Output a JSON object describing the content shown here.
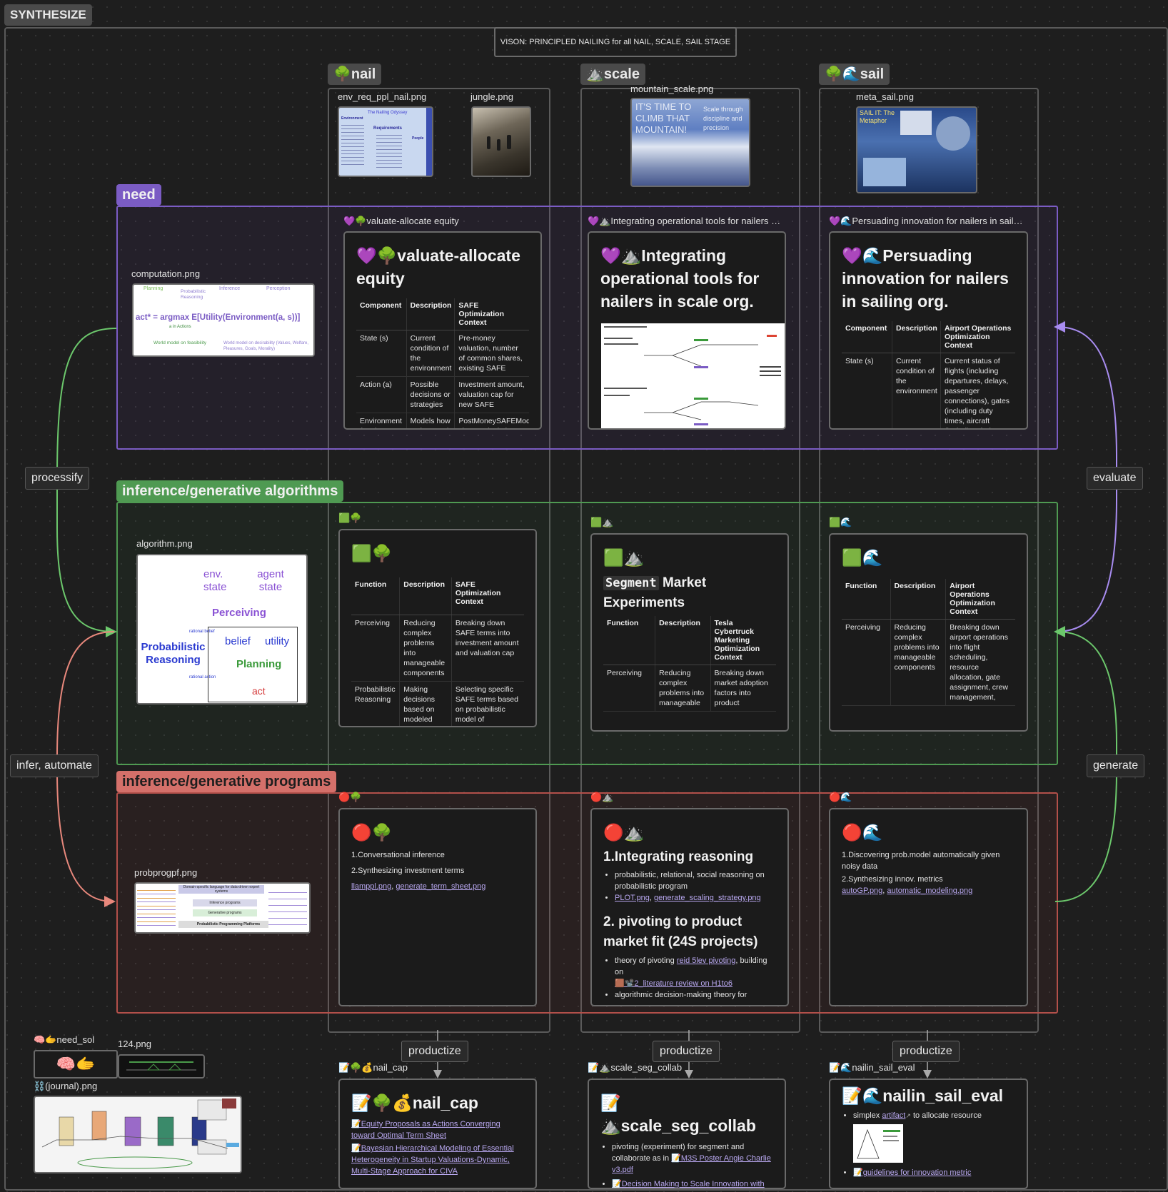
{
  "canvas_title": "SYNTHESIZE",
  "vision": "VISON: PRINCIPLED NAILING for all NAIL, SCALE, SAIL STAGE",
  "columns": {
    "nail": {
      "label": "🌳nail"
    },
    "scale": {
      "label": "⛰️scale"
    },
    "sail": {
      "label": "🌳🌊sail"
    }
  },
  "images": {
    "env_req": "env_req_ppl_nail.png",
    "jungle": "jungle.png",
    "mountain": "mountain_scale.png",
    "meta_sail": "meta_sail.png",
    "computation": "computation.png",
    "algorithm": "algorithm.png",
    "probprog": "probprogpf.png",
    "img124": "124.png",
    "journal": "⛓️(journal).png",
    "need_sol": "🧠🫱need_sol",
    "need_sol_emoji": "🧠🫱"
  },
  "thumb_text": {
    "env_title": "The Nailing Odyssey",
    "env_env": "Environment",
    "env_req": "Requirements",
    "env_people": "People",
    "mountain": "IT'S TIME TO CLIMB THAT MOUNTAIN!",
    "mountain_sub": "Scale through discipline and precision",
    "meta": "SAIL IT: The Metaphor"
  },
  "computation_fig": {
    "planning": "Planning",
    "probabilistic": "Probabilistic Reasoning",
    "inference": "Inference",
    "perception": "Perception",
    "formula": "act* = argmax E[Utility(Environment(a, s))]",
    "sub": "a in Actions",
    "feasibility": "World model on feasibility",
    "desirability": "World model on desirability (Values, Welfare, Pleasures, Goals, Morality)"
  },
  "algorithm_fig": {
    "env_state": "env. state",
    "agent_state": "agent state",
    "perceiving": "Perceiving",
    "belief": "belief",
    "utility": "utility",
    "planning": "Planning",
    "act": "act",
    "prob_reasoning": "Probabilistic Reasoning",
    "rational_belief": "rational belief",
    "rational_action": "rational action"
  },
  "probprog_fig": {
    "dsl": "Domain-specific language for data-driven expert systems",
    "inference_programs": "Inference programs",
    "generative_programs": "Generative programs",
    "platforms": "Probabilistic Programming Platforms"
  },
  "groups": {
    "need": "need",
    "algorithms": "inference/generative algorithms",
    "programs": "inference/generative programs"
  },
  "side_labels": {
    "processify": "processify",
    "infer": "infer, automate",
    "evaluate": "evaluate",
    "generate": "generate",
    "productize": "productize"
  },
  "need_cards": [
    {
      "label": "💜🌳valuate-allocate equity",
      "title": "💜🌳valuate-allocate equity",
      "headers": [
        "Component",
        "Description",
        "SAFE Optimization Context"
      ],
      "rows": [
        [
          "State (s)",
          "Current condition of the environment",
          "Pre-money valuation, number of common shares, existing SAFE"
        ],
        [
          "Action (a)",
          "Possible decisions or strategies",
          "Investment amount, valuation cap for new SAFE"
        ],
        [
          "Environment (Env)",
          "Models how actions and",
          "PostMoneySAFEModel class, calculating"
        ]
      ]
    },
    {
      "label": "💜⛰️Integrating operational tools for nailers …",
      "title": "💜⛰️Integrating operational tools for nailers in scale org."
    },
    {
      "label": "💜🌊Persuading innovation for nailers in sail…",
      "title": "💜🌊Persuading innovation for nailers in sailing org.",
      "headers": [
        "Component",
        "Description",
        "Airport Operations Optimization Context"
      ],
      "rows": [
        [
          "State (s)",
          "Current condition of the environment",
          "Current status of flights (including departures, delays, passenger connections), gates (including duty times, aircraft (including their capacity), and resources (manpower and eq"
        ]
      ]
    }
  ],
  "algo_cards": [
    {
      "label": "🟩🌳",
      "title": "🟩🌳",
      "headers": [
        "Function",
        "Description",
        "SAFE Optimization Context"
      ],
      "rows": [
        [
          "Perceiving",
          "Reducing complex problems into manageable components",
          "Breaking down SAFE terms into investment amount and valuation cap"
        ],
        [
          "Probabilistic Reasoning",
          "Making decisions based on modeled uncertainty",
          "Selecting specific SAFE terms based on probabilistic model of"
        ]
      ]
    },
    {
      "label": "🟩⛰️",
      "title": "🟩⛰️",
      "segment_code": "Segment",
      "segment_rest": "Market Experiments",
      "headers": [
        "Function",
        "Description",
        "Tesla Cybertruck Marketing Optimization Context"
      ],
      "rows": [
        [
          "Perceiving",
          "Reducing complex problems into manageable",
          "Breaking down market adoption factors into product"
        ]
      ]
    },
    {
      "label": "🟩🌊",
      "title": "🟩🌊",
      "headers": [
        "Function",
        "Description",
        "Airport Operations Optimization Context"
      ],
      "rows": [
        [
          "Perceiving",
          "Reducing complex problems into manageable components",
          "Breaking down airport operations into flight scheduling, resource allocation, gate assignment, crew management,"
        ]
      ]
    }
  ],
  "prog_cards": [
    {
      "label": "🔴🌳",
      "title": "🔴🌳",
      "lines": [
        "1.Conversational inference",
        "2.Synthesizing investment terms"
      ],
      "link1": "llamppl.png",
      "sep": ", ",
      "link2": "generate_term_sheet.png"
    },
    {
      "label": "🔴⛰️",
      "title": "🔴⛰️",
      "h1": "1.Integrating reasoning",
      "b1": "probabilistic, relational, social reasoning on probabilistic program",
      "b2_link1": "PLOT.png",
      "b2_sep": ", ",
      "b2_link2": "generate_scaling_strategy.png",
      "h2": "2. pivoting to product market fit (24S projects)",
      "b3_pre": "theory of pivoting ",
      "b3_link": "reid 5lev pivoting",
      "b3_post": ", building on",
      "b3_link2": "🟫📽️2_literature review on H1to6",
      "b4": "algorithmic decision-making theory for"
    },
    {
      "label": "🔴🌊",
      "title": "🔴🌊",
      "lines": [
        "1.Discovering prob.model automatically given noisy data",
        "2.Synthesizing innov. metrics"
      ],
      "link1": "autoGP.png",
      "sep": ", ",
      "link2": "automatic_modeling.png"
    }
  ],
  "prod_cards": [
    {
      "label": "📝🌳💰nail_cap",
      "title": "📝🌳💰nail_cap",
      "links": [
        "📝Equity Proposals as Actions Converging toward Optimal Term Sheet",
        "📝Bayesian Hierarchical Modeling of Essential Heterogeneity in Startup Valuations-Dynamic, Multi-Stage Approach for CIVA"
      ]
    },
    {
      "label": "📝⛰️scale_seg_collab",
      "title": "📝⛰️scale_seg_collab",
      "b1_pre": "pivoting (experiment) for segment and collaborate as in ",
      "b1_link": "📝M3S Poster Angie Charlie v3.pdf",
      "b2_link": "📝Decision Making to Scale Innovation with Integrated Reasoning"
    },
    {
      "label": "📝🌊nailin_sail_eval",
      "title": "📝🌊nailin_sail_eval",
      "b1_pre": "simplex ",
      "b1_link": "artifact",
      "b1_post": " to allocate resource",
      "b2_link": "📝guidelines for innovation metric"
    }
  ],
  "colors": {
    "background": "#1e1e1e",
    "need": "#7b5cc4",
    "algorithms": "#4f9a52",
    "programs": "#b3504a",
    "link": "#b9a8f0"
  }
}
